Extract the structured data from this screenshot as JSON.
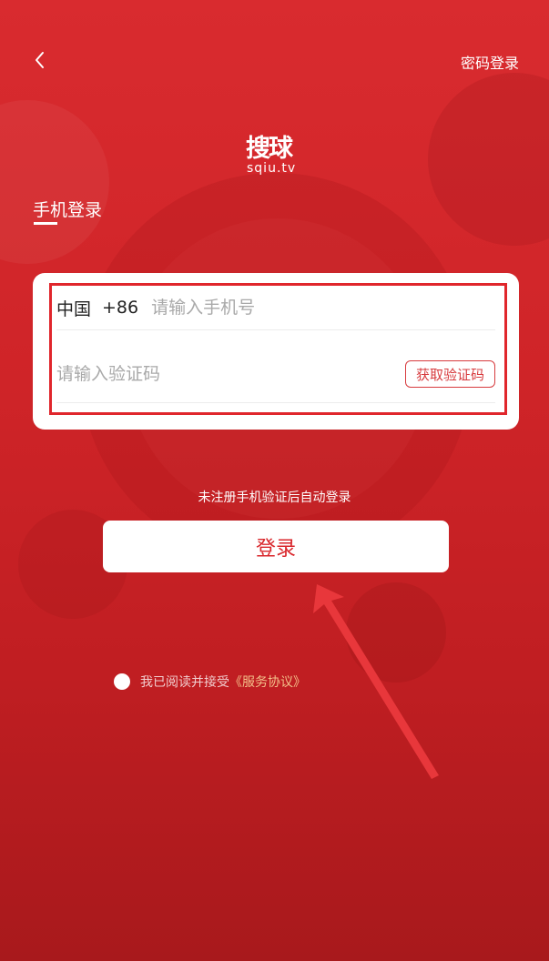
{
  "header": {
    "back_icon": "chevron-left-icon",
    "password_login": "密码登录"
  },
  "logo": {
    "main": "搜球",
    "sub": "sqiu.tv"
  },
  "tab": {
    "title": "手机登录"
  },
  "form": {
    "country": "中国",
    "country_code": "+86",
    "phone_placeholder": "请输入手机号",
    "code_placeholder": "请输入验证码",
    "get_code_label": "获取验证码"
  },
  "hint": "未注册手机验证后自动登录",
  "login_button": "登录",
  "agreement": {
    "text": "我已阅读并接受",
    "link": "《服务协议》"
  },
  "colors": {
    "background": "#d22629",
    "accent": "#d9262b",
    "highlight": "#e0262c",
    "link": "#f3c08a"
  }
}
